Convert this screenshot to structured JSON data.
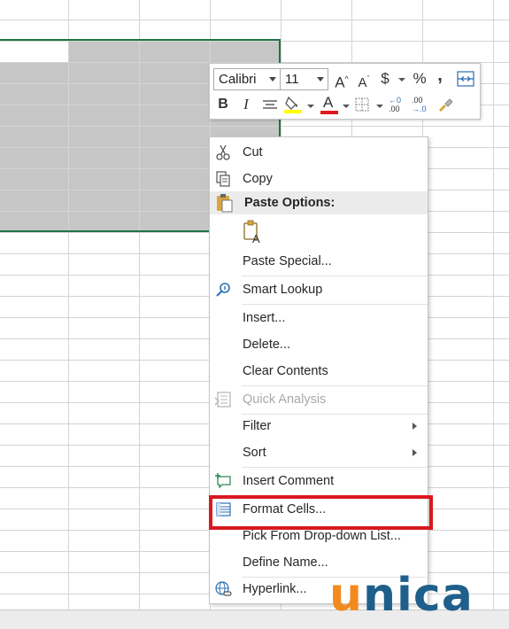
{
  "toolbar": {
    "font_name": "Calibri",
    "font_size": "11",
    "increase_font": "A",
    "decrease_font": "A",
    "currency": "$",
    "percent": "%",
    "comma": ",",
    "bold": "B",
    "italic": "I",
    "font_color_letter": "A",
    "font_color": "#e0181f",
    "fill_color": "#ffff00"
  },
  "menu": {
    "cut": "Cut",
    "copy": "Copy",
    "paste_options": "Paste Options:",
    "paste_special": "Paste Special...",
    "smart_lookup": "Smart Lookup",
    "insert": "Insert...",
    "delete": "Delete...",
    "clear_contents": "Clear Contents",
    "quick_analysis": "Quick Analysis",
    "filter": "Filter",
    "sort": "Sort",
    "insert_comment": "Insert Comment",
    "format_cells": "Format Cells...",
    "pick_list": "Pick From Drop-down List...",
    "define_name": "Define Name...",
    "hyperlink": "Hyperlink..."
  },
  "logo": {
    "first": "u",
    "rest": "nica"
  },
  "colors": {
    "selection_border": "#217346",
    "selection_fill": "#c6c6c6",
    "highlight_box": "#d91820",
    "logo_orange": "#f28b1f",
    "logo_blue": "#1f5f8b"
  }
}
